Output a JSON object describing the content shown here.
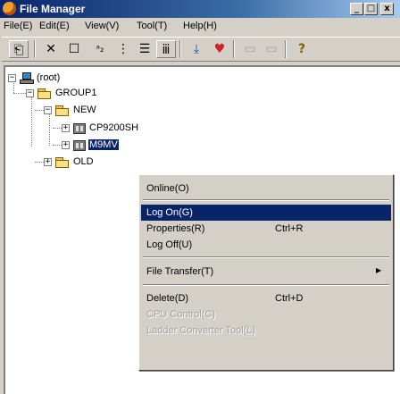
{
  "window": {
    "title": "File Manager"
  },
  "title_buttons": {
    "minimize": "_",
    "maximize": "□",
    "close": "x"
  },
  "menu": [
    "File(E)",
    "Edit(E)",
    "View(V)",
    "Tool(T)",
    "Help(H)"
  ],
  "toolbar": {
    "buttons": [
      {
        "name": "back-icon",
        "glyph": "⎗"
      },
      {
        "name": "delete-icon",
        "glyph": "✕"
      },
      {
        "name": "properties-icon",
        "glyph": "☐"
      },
      {
        "name": "large-icons-icon",
        "glyph": "ᵃ₂"
      },
      {
        "name": "small-icons-icon",
        "glyph": "⋮"
      },
      {
        "name": "list-view-icon",
        "glyph": "☰"
      },
      {
        "name": "details-view-icon",
        "glyph": "ⅲ"
      },
      {
        "name": "download-icon",
        "glyph": "⤓"
      },
      {
        "name": "upload-icon",
        "glyph": "♥"
      },
      {
        "name": "disabled-a-icon",
        "glyph": "▭"
      },
      {
        "name": "disabled-b-icon",
        "glyph": "▭"
      },
      {
        "name": "help-icon",
        "glyph": "?"
      }
    ]
  },
  "tree": {
    "root": "(root)",
    "group1": "GROUP1",
    "new_folder": "NEW",
    "cpu1": "CP9200SH",
    "cpu2_selected": "M9MV",
    "old_folder": "OLD"
  },
  "context_menu": {
    "items": [
      {
        "label": "Online(O)",
        "shortcut": "",
        "state": "normal"
      },
      {
        "label": "Log On(G)",
        "shortcut": "",
        "state": "highlighted"
      },
      {
        "label": "Properties(R)",
        "shortcut": "Ctrl+R",
        "state": "normal"
      },
      {
        "label": "Log Off(U)",
        "shortcut": "",
        "state": "normal"
      },
      {
        "label": "File Transfer(T)",
        "shortcut": "",
        "state": "submenu"
      },
      {
        "label": "Delete(D)",
        "shortcut": "Ctrl+D",
        "state": "normal"
      },
      {
        "label": "CPU Control(C)",
        "shortcut": "",
        "state": "disabled"
      },
      {
        "label": "Ladder Converter Tool(L)",
        "shortcut": "",
        "state": "disabled"
      }
    ]
  }
}
